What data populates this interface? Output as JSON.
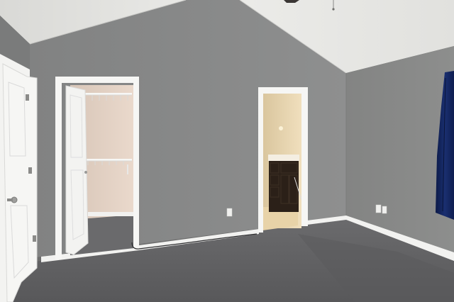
{
  "scene": {
    "description_tags": [
      "bedroom",
      "vaulted-ceiling",
      "walk-in-closet",
      "bathroom-doorway",
      "carpet",
      "curtain"
    ],
    "colors": {
      "ceiling": "#e4e4e1",
      "left_wall": "#7d7e7e",
      "center_wall": "#8b8c8c",
      "right_wall": "#888988",
      "carpet": "#626264",
      "trim": "#f4f4f2",
      "closet_interior": "#e3d2c4",
      "bathroom_light": "#e9d7b2",
      "vanity": "#2b2018",
      "curtain": "#13255c"
    }
  }
}
